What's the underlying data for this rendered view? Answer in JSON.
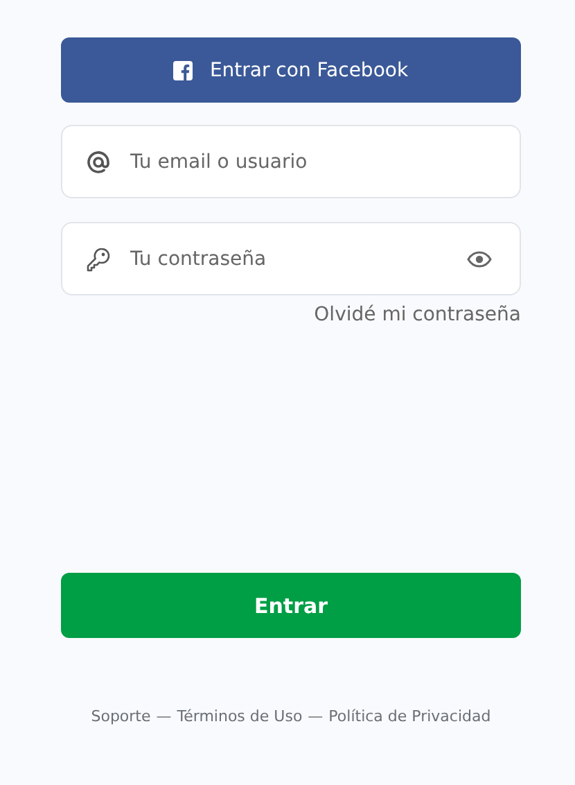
{
  "facebook_button": {
    "label": "Entrar con Facebook"
  },
  "fields": [
    {
      "kind": "email",
      "placeholder": "Tu email o usuario"
    },
    {
      "kind": "password",
      "placeholder": "Tu contraseña"
    }
  ],
  "forgot_link": "Olvidé mi contraseña",
  "submit_button": "Entrar",
  "footer": [
    {
      "kind": "link",
      "text": "Soporte"
    },
    {
      "kind": "separator",
      "text": "—"
    },
    {
      "kind": "link",
      "text": "Términos de Uso"
    },
    {
      "kind": "separator",
      "text": "—"
    },
    {
      "kind": "link",
      "text": "Política de Privacidad"
    }
  ]
}
